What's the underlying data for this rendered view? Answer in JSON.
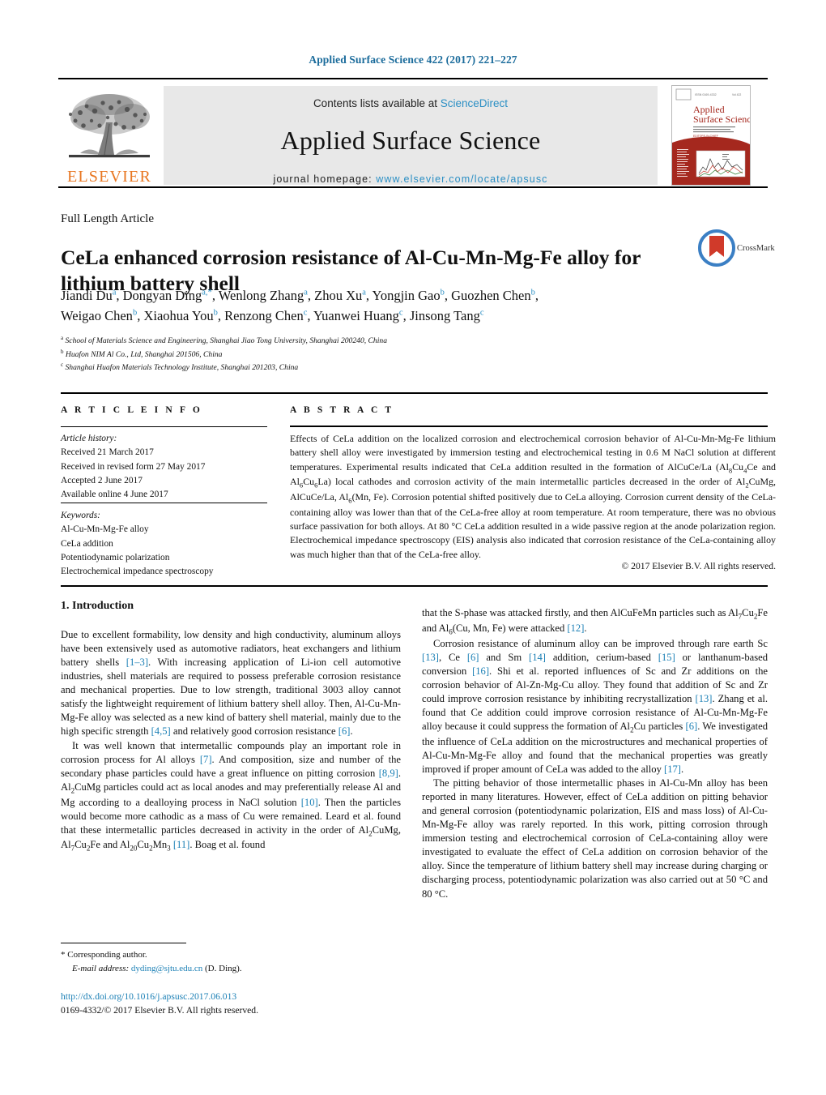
{
  "running_head": "Applied Surface Science 422 (2017) 221–227",
  "masthead": {
    "contents_prefix": "Contents lists available at ",
    "contents_link": "ScienceDirect",
    "journal_title": "Applied Surface Science",
    "homepage_prefix": "journal homepage: ",
    "homepage_url": "www.elsevier.com/locate/apsusc",
    "publisher_name": "ELSEVIER",
    "cover_title_line1": "Applied",
    "cover_title_line2": "Surface Science"
  },
  "article": {
    "type": "Full Length Article",
    "title": "CeLa enhanced corrosion resistance of Al-Cu-Mn-Mg-Fe alloy for lithium battery shell",
    "crossmark_label": "CrossMark",
    "authors_line1": "Jiandi Du<sup>a</sup>, Dongyan Ding<sup>a,*</sup>, Wenlong Zhang<sup>a</sup>, Zhou Xu<sup>a</sup>, Yongjin Gao<sup>b</sup>, Guozhen Chen<sup>b</sup>,",
    "authors_line2": "Weigao Chen<sup>b</sup>, Xiaohua You<sup>b</sup>, Renzong Chen<sup>c</sup>, Yuanwei Huang<sup>c</sup>, Jinsong Tang<sup>c</sup>",
    "affiliations": [
      "<sup>a</sup> School of Materials Science and Engineering, Shanghai Jiao Tong University, Shanghai 200240, China",
      "<sup>b</sup> Huafon NIM Al Co., Ltd, Shanghai 201506, China",
      "<sup>c</sup> Shanghai Huafon Materials Technology Institute, Shanghai 201203, China"
    ]
  },
  "article_info": {
    "heading": "A R T I C L E    I N F O",
    "history_label": "Article history:",
    "history": [
      "Received 21 March 2017",
      "Received in revised form 27 May 2017",
      "Accepted 2 June 2017",
      "Available online 4 June 2017"
    ],
    "keywords_label": "Keywords:",
    "keywords": [
      "Al-Cu-Mn-Mg-Fe alloy",
      "CeLa addition",
      "Potentiodynamic polarization",
      "Electrochemical impedance spectroscopy"
    ]
  },
  "abstract": {
    "heading": "A B S T R A C T",
    "text": "Effects of CeLa addition on the localized corrosion and electrochemical corrosion behavior of Al-Cu-Mn-Mg-Fe lithium battery shell alloy were investigated by immersion testing and electrochemical testing in 0.6 M NaCl solution at different temperatures. Experimental results indicated that CeLa addition resulted in the formation of AlCuCe/La (Al<sub>8</sub>Cu<sub>4</sub>Ce and Al<sub>6</sub>Cu<sub>6</sub>La) local cathodes and corrosion activity of the main intermetallic particles decreased in the order of Al<sub>2</sub>CuMg, AlCuCe/La, Al<sub>6</sub>(Mn, Fe). Corrosion potential shifted positively due to CeLa alloying. Corrosion current density of the CeLa-containing alloy was lower than that of the CeLa-free alloy at room temperature. At room temperature, there was no obvious surface passivation for both alloys. At 80 °C CeLa addition resulted in a wide passive region at the anode polarization region. Electrochemical impedance spectroscopy (EIS) analysis also indicated that corrosion resistance of the CeLa-containing alloy was much higher than that of the CeLa-free alloy.",
    "copyright": "© 2017 Elsevier B.V. All rights reserved."
  },
  "body": {
    "section_title": "1.  Introduction",
    "left_column": [
      "Due to excellent formability, low density and high conductivity, aluminum alloys have been extensively used as automotive radiators, heat exchangers and lithium battery shells <span class=\"ref\">[1–3]</span>. With increasing application of Li-ion cell automotive industries, shell materials are required to possess preferable corrosion resistance and mechanical properties. Due to low strength, traditional 3003 alloy cannot satisfy the lightweight requirement of lithium battery shell alloy. Then, Al-Cu-Mn-Mg-Fe alloy was selected as a new kind of battery shell material, mainly due to the high specific strength <span class=\"ref\">[4,5]</span> and relatively good corrosion resistance <span class=\"ref\">[6]</span>.",
      "It was well known that intermetallic compounds play an important role in corrosion process for Al alloys <span class=\"ref\">[7]</span>. And composition, size and number of the secondary phase particles could have a great influence on pitting corrosion <span class=\"ref\">[8,9]</span>. Al<sub>2</sub>CuMg particles could act as local anodes and may preferentially release Al and Mg according to a dealloying process in NaCl solution <span class=\"ref\">[10]</span>. Then the particles would become more cathodic as a mass of Cu were remained. Leard et al. found that these intermetallic particles decreased in activity in the order of Al<sub>2</sub>CuMg, Al<sub>7</sub>Cu<sub>2</sub>Fe and Al<sub>20</sub>Cu<sub>2</sub>Mn<sub>3</sub> <span class=\"ref\">[11]</span>. Boag et al. found"
    ],
    "right_column": [
      "that the S-phase was attacked firstly, and then AlCuFeMn particles such as Al<sub>7</sub>Cu<sub>2</sub>Fe and Al<sub>6</sub>(Cu, Mn, Fe) were attacked <span class=\"ref\">[12]</span>.",
      "Corrosion resistance of aluminum alloy can be improved through rare earth Sc <span class=\"ref\">[13]</span>, Ce <span class=\"ref\">[6]</span> and Sm <span class=\"ref\">[14]</span> addition, cerium-based <span class=\"ref\">[15]</span> or lanthanum-based conversion <span class=\"ref\">[16]</span>. Shi et al. reported influences of Sc and Zr additions on the corrosion behavior of Al-Zn-Mg-Cu alloy. They found that addition of Sc and Zr could improve corrosion resistance by inhibiting recrystallization <span class=\"ref\">[13]</span>. Zhang et al. found that Ce addition could improve corrosion resistance of Al-Cu-Mn-Mg-Fe alloy because it could suppress the formation of Al<sub>2</sub>Cu particles <span class=\"ref\">[6]</span>. We investigated the influence of CeLa addition on the microstructures and mechanical properties of Al-Cu-Mn-Mg-Fe alloy and found that the mechanical properties was greatly improved if proper amount of CeLa was added to the alloy <span class=\"ref\">[17]</span>.",
      "The pitting behavior of those intermetallic phases in Al-Cu-Mn alloy has been reported in many literatures. However, effect of CeLa addition on pitting behavior and general corrosion (potentiodynamic polarization, EIS and mass loss) of Al-Cu-Mn-Mg-Fe alloy was rarely reported. In this work, pitting corrosion through immersion testing and electrochemical corrosion of CeLa-containing alloy were investigated to evaluate the effect of CeLa addition on corrosion behavior of the alloy. Since the temperature of lithium battery shell may increase during charging or discharging process, potentiodynamic polarization was also carried out at 50 °C and 80 °C."
    ]
  },
  "footer": {
    "corresponding_marker": "*",
    "corresponding_text": "Corresponding author.",
    "email_label": "E-mail address:",
    "email": "dyding@sjtu.edu.cn",
    "email_suffix": "(D. Ding).",
    "doi": "http://dx.doi.org/10.1016/j.apsusc.2017.06.013",
    "issn_line": "0169-4332/© 2017 Elsevier B.V. All rights reserved."
  },
  "colors": {
    "link": "#1a7fb5",
    "masthead_link": "#2b8fc4",
    "elsevier_orange": "#e87722",
    "crossmark_blue": "#3b7fc4",
    "crossmark_red": "#d03a2a",
    "grey_panel": "#e8e8e8"
  }
}
